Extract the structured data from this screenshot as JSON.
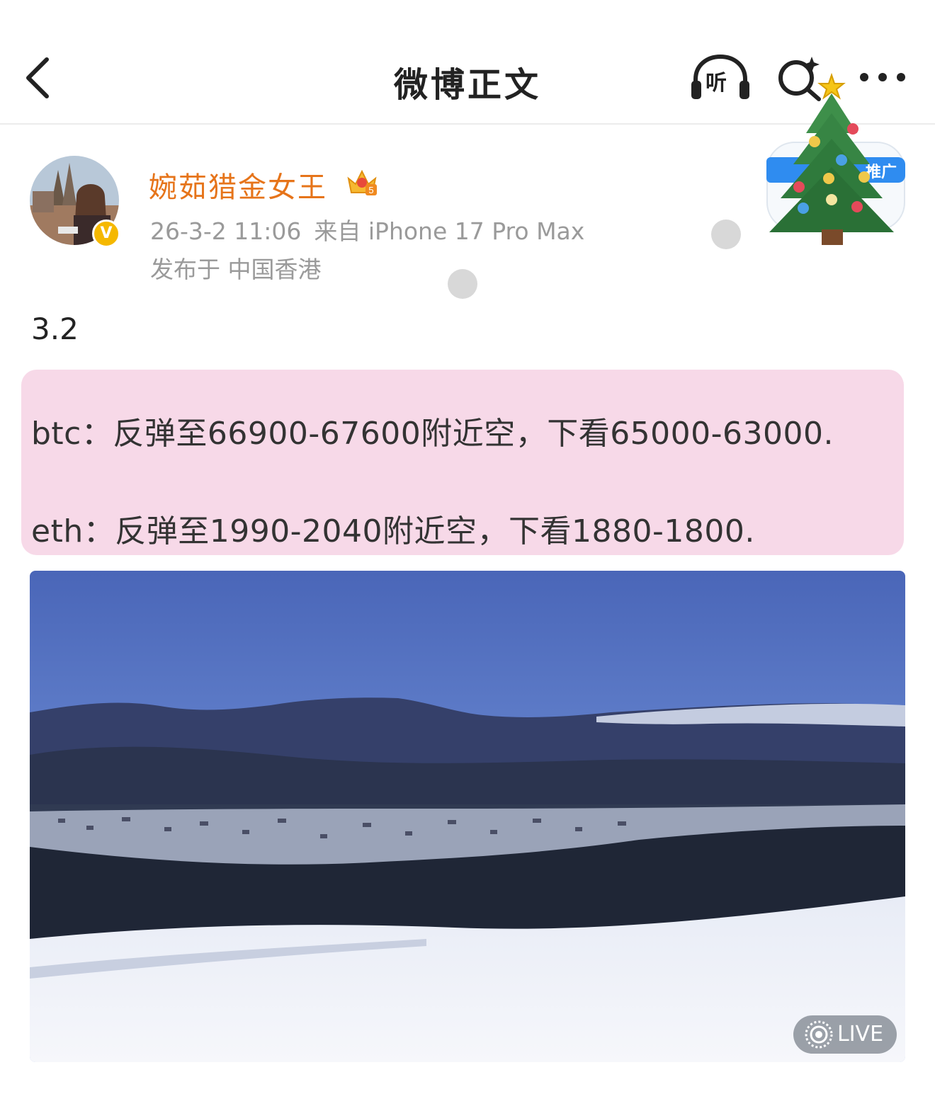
{
  "header": {
    "title": "微博正文",
    "listen_label": "听",
    "icons": [
      "back-arrow-icon",
      "headphones-icon",
      "ai-search-icon",
      "more-icon"
    ]
  },
  "promo": {
    "badge_label": "推广",
    "icon": "christmas-tree-icon"
  },
  "post": {
    "author_name": "婉茹猎金女王",
    "member_level": "5",
    "verified_mark": "V",
    "timestamp": "26-3-2 11:06",
    "source": "来自 iPhone 17 Pro Max",
    "location": "发布于 中国香港",
    "date_text": "3.2",
    "highlight_lines": [
      "btc：反弹至66900-67600附近空，下看65000-63000.",
      "eth：反弹至1990-2040附近空，下看1880-1800."
    ],
    "photo": {
      "subject": "snowy-mountain-village-photo",
      "live_label": "LIVE"
    }
  },
  "colors": {
    "author_name": "#e6741a",
    "meta_text": "#9a9a9a",
    "highlight_bg": "#f7d9e8",
    "verified_badge": "#f5b800",
    "promo_badge": "#2f8cf0"
  }
}
